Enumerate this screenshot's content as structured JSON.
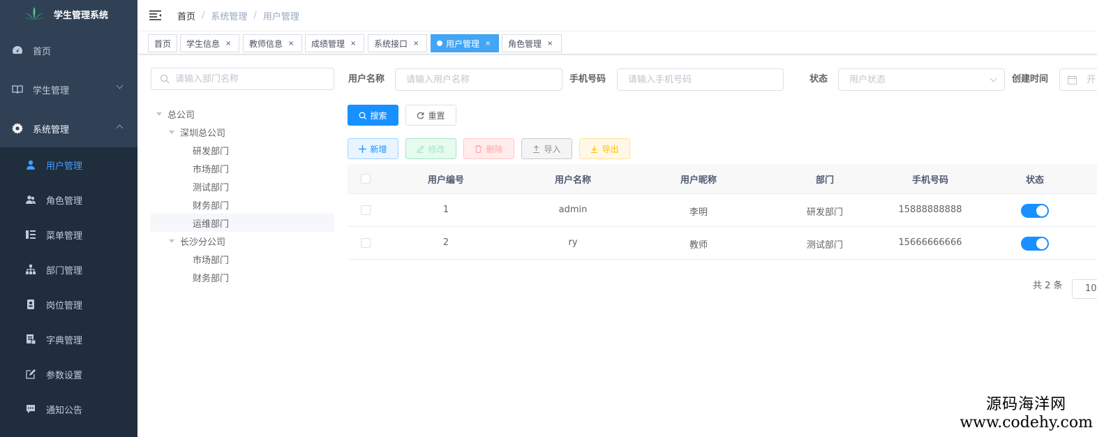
{
  "app": {
    "title": "学生管理系统"
  },
  "sidebar": {
    "home": "首页",
    "student_mgmt": "学生管理",
    "system_mgmt": "系统管理",
    "sub_items": [
      {
        "label": "用户管理",
        "icon": "user-icon",
        "active": true
      },
      {
        "label": "角色管理",
        "icon": "peoples-icon"
      },
      {
        "label": "菜单管理",
        "icon": "tree-table-icon"
      },
      {
        "label": "部门管理",
        "icon": "tree-icon"
      },
      {
        "label": "岗位管理",
        "icon": "post-icon"
      },
      {
        "label": "字典管理",
        "icon": "dict-icon"
      },
      {
        "label": "参数设置",
        "icon": "edit-icon"
      },
      {
        "label": "通知公告",
        "icon": "message-icon"
      }
    ]
  },
  "breadcrumb": {
    "home": "首页",
    "level1": "系统管理",
    "level2": "用户管理",
    "sep": "/"
  },
  "tags": [
    "首页",
    "学生信息",
    "教师信息",
    "成绩管理",
    "系统接口",
    "用户管理",
    "角色管理"
  ],
  "tag_close": "×",
  "dept_tree": {
    "search_placeholder": "请输入部门名称",
    "nodes": [
      {
        "label": "总公司",
        "level": 0,
        "expanded": true
      },
      {
        "label": "深圳总公司",
        "level": 1,
        "expanded": true
      },
      {
        "label": "研发部门",
        "level": 2
      },
      {
        "label": "市场部门",
        "level": 2
      },
      {
        "label": "测试部门",
        "level": 2
      },
      {
        "label": "财务部门",
        "level": 2
      },
      {
        "label": "运维部门",
        "level": 2,
        "current": true
      },
      {
        "label": "长沙分公司",
        "level": 1,
        "expanded": true
      },
      {
        "label": "市场部门",
        "level": 2
      },
      {
        "label": "财务部门",
        "level": 2
      }
    ]
  },
  "query": {
    "username_label": "用户名称",
    "username_placeholder": "请输入用户名称",
    "phone_label": "手机号码",
    "phone_placeholder": "请输入手机号码",
    "status_label": "状态",
    "status_placeholder": "用户状态",
    "created_label": "创建时间",
    "created_placeholder": "开"
  },
  "buttons": {
    "search": "搜索",
    "reset": "重置",
    "add": "新增",
    "edit": "修改",
    "delete": "删除",
    "import": "导入",
    "export": "导出"
  },
  "table": {
    "columns": [
      "用户编号",
      "用户名称",
      "用户昵称",
      "部门",
      "手机号码",
      "状态"
    ],
    "rows": [
      {
        "id": "1",
        "username": "admin",
        "nickname": "李明",
        "dept": "研发部门",
        "phone": "15888888888",
        "status": true
      },
      {
        "id": "2",
        "username": "ry",
        "nickname": "教师",
        "dept": "测试部门",
        "phone": "15666666666",
        "status": true
      }
    ]
  },
  "pagination": {
    "total_text": "共 2 条",
    "page_size": "10"
  },
  "watermark": {
    "line1": "源码海洋网",
    "line2": "www.codehy.com"
  },
  "colors": {
    "sidebar_bg": "#304156",
    "submenu_bg": "#1f2d3d",
    "primary": "#1890ff",
    "active_tag": "#42a5f5"
  }
}
